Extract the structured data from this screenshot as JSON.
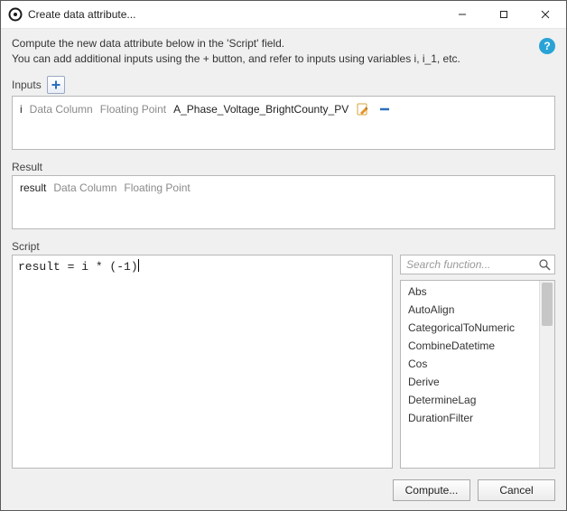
{
  "window": {
    "title": "Create data attribute..."
  },
  "description": {
    "line1": "Compute the new data attribute below in the 'Script' field.",
    "line2": "You can add additional inputs using the + button, and refer to inputs using variables i, i_1, etc."
  },
  "sections": {
    "inputs_label": "Inputs",
    "result_label": "Result",
    "script_label": "Script"
  },
  "inputs": {
    "items": [
      {
        "var": "i",
        "kind": "Data Column",
        "dtype": "Floating Point",
        "name": "A_Phase_Voltage_BrightCounty_PV"
      }
    ]
  },
  "result": {
    "var": "result",
    "kind": "Data Column",
    "dtype": "Floating Point"
  },
  "script": {
    "text": "result = i * (-1)"
  },
  "search": {
    "placeholder": "Search function..."
  },
  "functions": [
    "Abs",
    "AutoAlign",
    "CategoricalToNumeric",
    "CombineDatetime",
    "Cos",
    "Derive",
    "DetermineLag",
    "DurationFilter"
  ],
  "footer": {
    "compute": "Compute...",
    "cancel": "Cancel"
  }
}
